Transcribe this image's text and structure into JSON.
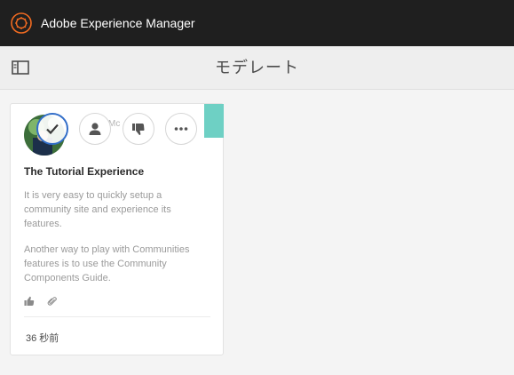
{
  "header": {
    "app_title": "Adobe Experience Manager",
    "logo_icon": "aem-logo-icon"
  },
  "action_bar": {
    "page_title": "モデレート",
    "rail_toggle_icon": "sidebar-toggle-icon"
  },
  "card": {
    "author": "Mc",
    "title": "The Tutorial Experience",
    "paragraphs": [
      "It is very easy to quickly setup a community site and experience its features.",
      "Another way to play with Communities features is to use the Community Components Guide."
    ],
    "quick_actions": [
      {
        "name": "approve",
        "icon": "checkmark-icon"
      },
      {
        "name": "user",
        "icon": "user-icon"
      },
      {
        "name": "deny",
        "icon": "thumbs-down-icon"
      },
      {
        "name": "more",
        "icon": "more-icon"
      }
    ],
    "meta_icons": [
      "thumbs-up-icon",
      "attachment-icon"
    ],
    "timestamp": "36 秒前",
    "status_color": "#6ed0c4"
  },
  "colors": {
    "topbar": "#1f1f1f",
    "logo_accent": "#f26b21",
    "selection": "#326ec8"
  }
}
